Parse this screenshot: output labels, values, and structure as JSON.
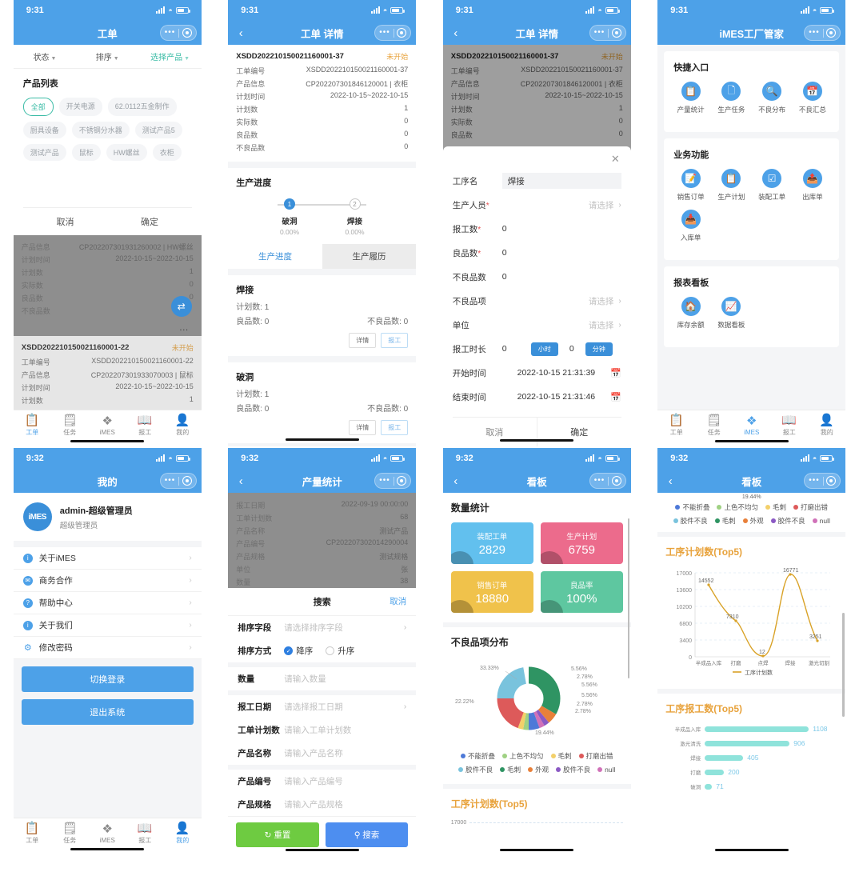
{
  "panel1": {
    "status_time": "9:31",
    "nav_title": "工单",
    "filters": [
      "状态",
      "排序",
      "选择产品"
    ],
    "product_list_title": "产品列表",
    "tags": [
      "全部",
      "开关电源",
      "62.0112五金制作",
      "厨具设备",
      "不锈钢分水器",
      "测试产品5",
      "测试产品",
      "鼠标",
      "HW螺丝",
      "衣柜"
    ],
    "selected_tag": "全部",
    "cancel": "取消",
    "confirm": "确定",
    "dim_card": {
      "rows": [
        {
          "k": "产品信息",
          "v": "CP202207301931260002 | HW螺丝"
        },
        {
          "k": "计划时间",
          "v": "2022-10-15~2022-10-15"
        },
        {
          "k": "计划数",
          "v": "1"
        },
        {
          "k": "实际数",
          "v": "0"
        },
        {
          "k": "良品数",
          "v": "0"
        },
        {
          "k": "不良品数",
          "v": ""
        }
      ]
    },
    "wo_card": {
      "no": "XSDD202210150021160001-22",
      "status": "未开始",
      "rows": [
        {
          "k": "工单编号",
          "v": "XSDD202210150021160001-22"
        },
        {
          "k": "产品信息",
          "v": "CP202207301933070003 | 鼠标"
        },
        {
          "k": "计划时间",
          "v": "2022-10-15~2022-10-15"
        },
        {
          "k": "计划数",
          "v": "1"
        }
      ]
    },
    "tabs": [
      {
        "label": "工单",
        "icon": "clipboard-icon",
        "active": true
      },
      {
        "label": "任务",
        "icon": "task-list-icon",
        "active": false
      },
      {
        "label": "iMES",
        "icon": "mes-grid-icon",
        "active": false
      },
      {
        "label": "报工",
        "icon": "book-icon",
        "active": false
      },
      {
        "label": "我的",
        "icon": "person-icon",
        "active": false
      }
    ]
  },
  "panel2": {
    "status_time": "9:31",
    "nav_title": "工单 详情",
    "wo_no": "XSDD202210150021160001-37",
    "wo_status": "未开始",
    "rows": [
      {
        "k": "工单编号",
        "v": "XSDD202210150021160001-37"
      },
      {
        "k": "产品信息",
        "v": "CP202207301846120001 | 衣柜"
      },
      {
        "k": "计划时间",
        "v": "2022-10-15~2022-10-15"
      },
      {
        "k": "计划数",
        "v": "1"
      },
      {
        "k": "实际数",
        "v": "0"
      },
      {
        "k": "良品数",
        "v": "0"
      },
      {
        "k": "不良品数",
        "v": "0"
      }
    ],
    "progress_title": "生产进度",
    "steps": [
      {
        "n": "1",
        "label": "破洞",
        "pct": "0.00%",
        "active": true
      },
      {
        "n": "2",
        "label": "焊接",
        "pct": "0.00%",
        "active": false
      }
    ],
    "tabs": [
      {
        "label": "生产进度",
        "on": true
      },
      {
        "label": "生产履历",
        "on": false
      }
    ],
    "ops": [
      {
        "name": "焊接",
        "plan": "计划数: 1",
        "good": "良品数: 0",
        "bad": "不良品数: 0",
        "b1": "详情",
        "b2": "报工"
      },
      {
        "name": "破洞",
        "plan": "计划数: 1",
        "good": "良品数: 0",
        "bad": "不良品数: 0",
        "b1": "详情",
        "b2": "报工"
      }
    ]
  },
  "panel3": {
    "status_time": "9:31",
    "nav_title": "工单 详情",
    "wo_no": "XSDD202210150021160001-37",
    "wo_status": "未开始",
    "rows": [
      {
        "k": "工单编号",
        "v": "XSDD202210150021160001-37"
      },
      {
        "k": "产品信息",
        "v": "CP202207301846120001 | 衣柜"
      },
      {
        "k": "计划时间",
        "v": "2022-10-15~2022-10-15"
      },
      {
        "k": "计划数",
        "v": "1"
      },
      {
        "k": "实际数",
        "v": "0"
      },
      {
        "k": "良品数",
        "v": "0"
      }
    ],
    "modal": {
      "close_icon": "close-icon",
      "process_name_label": "工序名",
      "process_name_value": "焊接",
      "worker_label": "生产人员",
      "worker_placeholder": "请选择",
      "report_qty_label": "报工数",
      "report_qty_value": "0",
      "good_qty_label": "良品数",
      "good_qty_value": "0",
      "bad_qty_label": "不良品数",
      "bad_qty_value": "0",
      "bad_item_label": "不良品项",
      "bad_item_placeholder": "请选择",
      "unit_label": "单位",
      "unit_placeholder": "请选择",
      "duration_label": "报工时长",
      "duration_hours": "0",
      "hours_unit": "小时",
      "duration_minutes": "0",
      "minutes_unit": "分钟",
      "start_label": "开始时间",
      "start_value": "2022-10-15 21:31:39",
      "end_label": "结束时间",
      "end_value": "2022-10-15 21:31:46",
      "cancel": "取消",
      "confirm": "确定"
    }
  },
  "panel4": {
    "status_time": "9:31",
    "nav_title": "iMES工厂管家",
    "sections": [
      {
        "title": "快捷入口",
        "items": [
          {
            "label": "产量统计",
            "icon": "chart-clipboard-icon"
          },
          {
            "label": "生产任务",
            "icon": "task-doc-icon"
          },
          {
            "label": "不良分布",
            "icon": "search-doc-icon"
          },
          {
            "label": "不良汇总",
            "icon": "calendar-icon"
          }
        ]
      },
      {
        "title": "业务功能",
        "items": [
          {
            "label": "销售订单",
            "icon": "edit-doc-icon"
          },
          {
            "label": "生产计划",
            "icon": "plan-doc-icon"
          },
          {
            "label": "装配工单",
            "icon": "check-doc-icon"
          },
          {
            "label": "出库单",
            "icon": "outbound-icon"
          },
          {
            "label": "入库单",
            "icon": "inbound-icon"
          }
        ]
      },
      {
        "title": "报表看板",
        "items": [
          {
            "label": "库存余额",
            "icon": "home-chart-icon"
          },
          {
            "label": "数据看板",
            "icon": "dashboard-icon"
          }
        ]
      }
    ],
    "tabs": [
      {
        "label": "工单",
        "active": false
      },
      {
        "label": "任务",
        "active": false
      },
      {
        "label": "iMES",
        "active": true
      },
      {
        "label": "报工",
        "active": false
      },
      {
        "label": "我的",
        "active": false
      }
    ]
  },
  "panel5": {
    "status_time": "9:32",
    "nav_title": "我的",
    "avatar_text": "iMES",
    "user_name": "admin-超级管理员",
    "user_role": "超级管理员",
    "menu": [
      {
        "label": "关于iMES",
        "icon": "info-icon",
        "color": "#4da1e8"
      },
      {
        "label": "商务合作",
        "icon": "mail-icon",
        "color": "#4da1e8"
      },
      {
        "label": "帮助中心",
        "icon": "question-icon",
        "color": "#4da1e8"
      },
      {
        "label": "关于我们",
        "icon": "info-icon",
        "color": "#4da1e8"
      },
      {
        "label": "修改密码",
        "icon": "gear-icon",
        "color": "#4da1e8"
      }
    ],
    "switch_login": "切换登录",
    "logout": "退出系统",
    "tabs": [
      {
        "label": "工单",
        "active": false
      },
      {
        "label": "任务",
        "active": false
      },
      {
        "label": "iMES",
        "active": false
      },
      {
        "label": "报工",
        "active": false
      },
      {
        "label": "我的",
        "active": true
      }
    ]
  },
  "panel6": {
    "status_time": "9:32",
    "nav_title": "产量统计",
    "bg_rows": [
      {
        "k": "报工日期",
        "v": "2022-09-19 00:00:00"
      },
      {
        "k": "工单计划数",
        "v": "68"
      },
      {
        "k": "产品名称",
        "v": "测试产品"
      },
      {
        "k": "产品编号",
        "v": "CP202207302014290004"
      },
      {
        "k": "产品规格",
        "v": "测试规格"
      },
      {
        "k": "单位",
        "v": "张"
      },
      {
        "k": "数量",
        "v": "38"
      }
    ],
    "sheet_title": "搜索",
    "sheet_cancel": "取消",
    "sort_field_label": "排序字段",
    "sort_field_placeholder": "请选择排序字段",
    "sort_mode_label": "排序方式",
    "sort_desc": "降序",
    "sort_asc": "升序",
    "sort_selected": "降序",
    "fields": [
      {
        "label": "数量",
        "placeholder": "请输入数量",
        "chev": false
      },
      {
        "label": "报工日期",
        "placeholder": "请选择报工日期",
        "chev": true
      },
      {
        "label": "工单计划数",
        "placeholder": "请输入工单计划数",
        "chev": false
      },
      {
        "label": "产品名称",
        "placeholder": "请输入产品名称",
        "chev": false
      },
      {
        "label": "产品编号",
        "placeholder": "请输入产品编号",
        "chev": false
      },
      {
        "label": "产品规格",
        "placeholder": "请输入产品规格",
        "chev": false
      }
    ],
    "reset_btn": "重置",
    "search_btn": "搜索"
  },
  "panel7": {
    "status_time": "9:32",
    "nav_title": "看板",
    "qty_title": "数量统计",
    "stats": [
      {
        "label": "装配工单",
        "value": "2829",
        "color": "#62c0ee"
      },
      {
        "label": "生产计划",
        "value": "6759",
        "color": "#ec6b8c"
      },
      {
        "label": "销售订单",
        "value": "18880",
        "color": "#f0c24b"
      },
      {
        "label": "良品率",
        "value": "100%",
        "color": "#5ec7a0"
      }
    ],
    "pie_title": "不良品项分布",
    "next_title_main": "工序计划数",
    "next_title_sub": "(Top5)",
    "next_axis_top": "17000"
  },
  "panel8": {
    "status_time": "9:32",
    "nav_title": "看板",
    "pie_tail_label": "19.44%",
    "line_title_main": "工序计划数",
    "line_title_sub": "(Top5)",
    "bar_title_main": "工序报工数",
    "bar_title_sub": "(Top5)"
  },
  "chart_data": [
    {
      "type": "pie",
      "title": "不良品项分布",
      "labels": [
        "不能折叠",
        "上色不均匀",
        "毛刺",
        "打磨出错",
        "胶件不良",
        "毛刺",
        "外观",
        "胶件不良",
        "null"
      ],
      "values": [
        5.56,
        2.78,
        2.78,
        19.44,
        22.22,
        33.33,
        5.56,
        5.56,
        2.78
      ],
      "value_labels": [
        "5.56%",
        "2.78%",
        "2.78%",
        "19.44%",
        "22.22%",
        "33.33%",
        "5.56%",
        "5.56%",
        "2.78%"
      ],
      "colors": [
        "#4d79d8",
        "#9fd183",
        "#f3d06a",
        "#dd5a5a",
        "#79c3dd",
        "#2f9463",
        "#e8803a",
        "#8b59c4",
        "#d071b8"
      ],
      "legend_position": "bottom"
    },
    {
      "type": "line",
      "title": "工序计划数(Top5)",
      "categories": [
        "半成品入库",
        "打磨",
        "点焊",
        "焊接",
        "激光切割"
      ],
      "values": [
        14552,
        7310,
        12,
        16771,
        3251
      ],
      "series_name": "工序计划数",
      "yticks": [
        0,
        3400,
        6800,
        10200,
        13600,
        17000
      ],
      "ylim": [
        0,
        17000
      ],
      "color": "#d9a227",
      "grid": true
    },
    {
      "type": "bar",
      "title": "工序报工数(Top5)",
      "orientation": "horizontal",
      "categories": [
        "半成品入库",
        "激光清洗",
        "焊接",
        "打磨",
        "破洞"
      ],
      "values": [
        1108,
        906,
        405,
        200,
        71
      ],
      "color": "#8fe3db",
      "label_color": "#7ec9e8"
    }
  ]
}
